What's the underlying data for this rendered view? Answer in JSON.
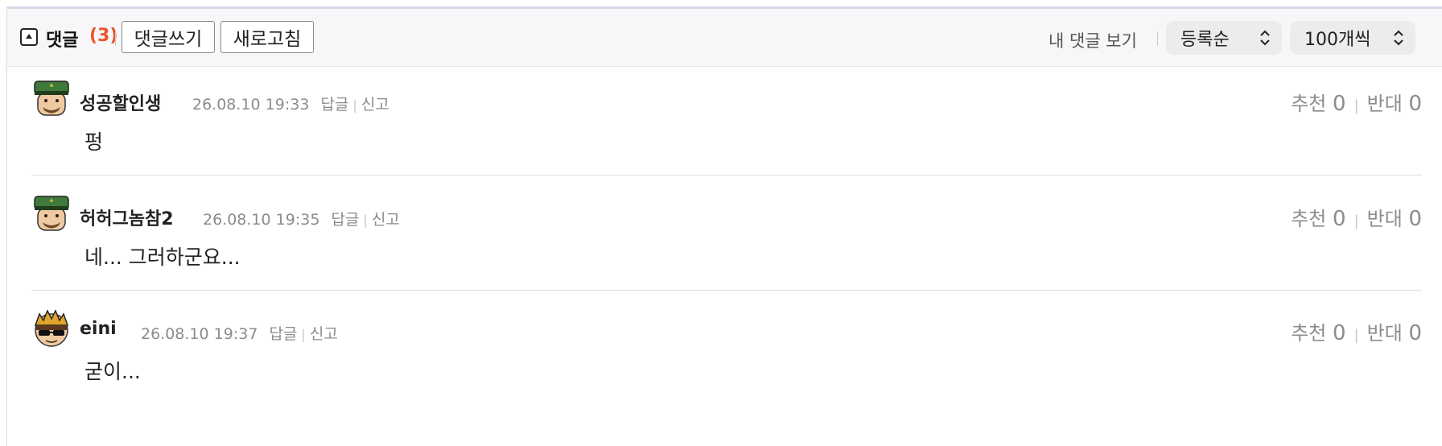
{
  "header": {
    "comments_label": "댓글",
    "comments_count": "(3)",
    "write_button": "댓글쓰기",
    "refresh_button": "새로고침",
    "my_comments_link": "내 댓글 보기",
    "sort_select": "등록순",
    "page_size_select": "100개씩"
  },
  "comments": [
    {
      "nickname": "성공할인생",
      "datetime": "26.08.10 19:33",
      "reply": "답글",
      "report": "신고",
      "text": "펑",
      "upvote_label": "추천",
      "upvote_count": "0",
      "downvote_label": "반대",
      "downvote_count": "0",
      "avatar": "general-hat-avatar"
    },
    {
      "nickname": "허허그놈참2",
      "datetime": "26.08.10 19:35",
      "reply": "답글",
      "report": "신고",
      "text": "네... 그러하군요...",
      "upvote_label": "추천",
      "upvote_count": "0",
      "downvote_label": "반대",
      "downvote_count": "0",
      "avatar": "general-hat-avatar"
    },
    {
      "nickname": "eini",
      "datetime": "26.08.10 19:37",
      "reply": "답글",
      "report": "신고",
      "text": "굳이...",
      "upvote_label": "추천",
      "upvote_count": "0",
      "downvote_label": "반대",
      "downvote_count": "0",
      "avatar": "spiky-sunglasses-avatar"
    }
  ],
  "colors": {
    "count_accent": "#e8542a",
    "header_bg": "#f7f7f9",
    "select_bg": "#ececef",
    "meta_text": "#8c8c8c"
  }
}
